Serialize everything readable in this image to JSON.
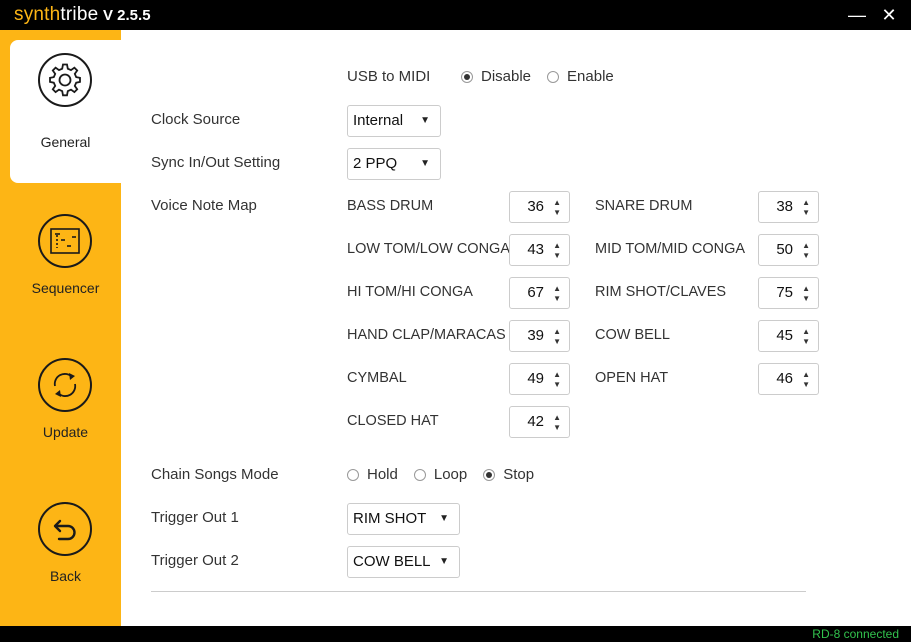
{
  "app": {
    "brand_part1": "synth",
    "brand_part2": "tribe",
    "version": "V 2.5.5"
  },
  "window": {
    "minimize": "—",
    "close": "✕"
  },
  "sidebar": {
    "items": [
      {
        "label": "General",
        "icon": "gear-icon",
        "active": true
      },
      {
        "label": "Sequencer",
        "icon": "sequencer-icon",
        "active": false
      },
      {
        "label": "Update",
        "icon": "refresh-icon",
        "active": false
      },
      {
        "label": "Back",
        "icon": "back-arrow-icon",
        "active": false
      }
    ]
  },
  "general": {
    "usb_midi": {
      "label": "USB to MIDI",
      "options": [
        "Disable",
        "Enable"
      ],
      "selected": "Disable"
    },
    "clock_source": {
      "label": "Clock Source",
      "value": "Internal"
    },
    "sync": {
      "label": "Sync In/Out Setting",
      "value": "2 PPQ"
    },
    "voice_note_map": {
      "label": "Voice Note Map",
      "voices": [
        {
          "name": "BASS DRUM",
          "value": "36"
        },
        {
          "name": "SNARE DRUM",
          "value": "38"
        },
        {
          "name": "LOW TOM/LOW CONGA",
          "value": "43"
        },
        {
          "name": "MID TOM/MID CONGA",
          "value": "50"
        },
        {
          "name": "HI TOM/HI CONGA",
          "value": "67"
        },
        {
          "name": "RIM SHOT/CLAVES",
          "value": "75"
        },
        {
          "name": "HAND CLAP/MARACAS",
          "value": "39"
        },
        {
          "name": "COW BELL",
          "value": "45"
        },
        {
          "name": "CYMBAL",
          "value": "49"
        },
        {
          "name": "OPEN HAT",
          "value": "46"
        },
        {
          "name": "CLOSED HAT",
          "value": "42"
        }
      ]
    },
    "chain_songs": {
      "label": "Chain Songs Mode",
      "options": [
        "Hold",
        "Loop",
        "Stop"
      ],
      "selected": "Stop"
    },
    "trigger_out_1": {
      "label": "Trigger Out 1",
      "value": "RIM SHOT"
    },
    "trigger_out_2": {
      "label": "Trigger Out 2",
      "value": "COW BELL"
    }
  },
  "status": {
    "text": "RD-8 connected",
    "color": "#32c24d"
  },
  "colors": {
    "accent": "#fdb515",
    "titlebar": "#000000"
  }
}
